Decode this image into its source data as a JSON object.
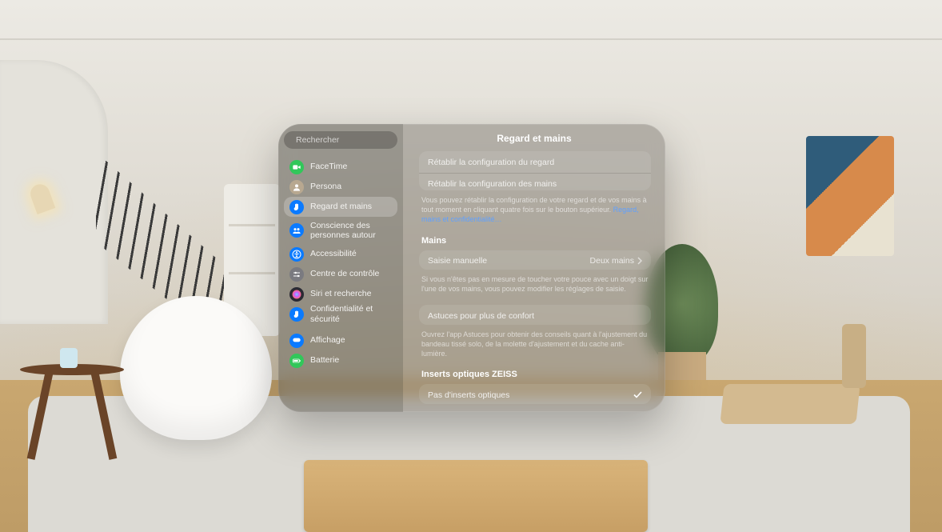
{
  "search": {
    "placeholder": "Rechercher"
  },
  "sidebar": {
    "items": [
      {
        "label": "FaceTime",
        "icon": "facetime",
        "bg": "#31c75a"
      },
      {
        "label": "Persona",
        "icon": "persona",
        "bg": "#b8a890"
      },
      {
        "label": "Regard et mains",
        "icon": "hand",
        "bg": "#0a7aff",
        "selected": true
      },
      {
        "label": "Conscience des personnes autour",
        "icon": "people",
        "bg": "#0a7aff",
        "tall": true
      },
      {
        "label": "Accessibilité",
        "icon": "access",
        "bg": "#0a7aff"
      },
      {
        "label": "Centre de contrôle",
        "icon": "sliders",
        "bg": "#7a7a80"
      },
      {
        "label": "Siri et recherche",
        "icon": "siri",
        "bg": "#2a2a34"
      },
      {
        "label": "Confidentialité et sécurité",
        "icon": "hand",
        "bg": "#0a7aff"
      },
      {
        "label": "Affichage",
        "icon": "display",
        "bg": "#0a7aff"
      },
      {
        "label": "Batterie",
        "icon": "battery",
        "bg": "#31c75a"
      }
    ]
  },
  "content": {
    "title": "Regard et mains",
    "reset": {
      "eyes": "Rétablir la configuration du regard",
      "hands": "Rétablir la configuration des mains",
      "foot": "Vous pouvez rétablir la configuration de votre regard et de vos mains à tout moment en cliquant quatre fois sur le bouton supérieur. ",
      "link": "Regard, mains et confidentialité…"
    },
    "hands": {
      "header": "Mains",
      "row_label": "Saisie manuelle",
      "row_value": "Deux mains",
      "foot": "Si vous n'êtes pas en mesure de toucher votre pouce avec un doigt sur l'une de vos mains, vous pouvez modifier les réglages de saisie."
    },
    "tips": {
      "row": "Astuces pour plus de confort",
      "foot": "Ouvrez l'app Astuces pour obtenir des conseils quant à l'ajustement du bandeau tissé solo, de la molette d'ajustement et du cache anti-lumière."
    },
    "zeiss": {
      "header": "Inserts optiques ZEISS",
      "row": "Pas d'inserts optiques"
    }
  }
}
